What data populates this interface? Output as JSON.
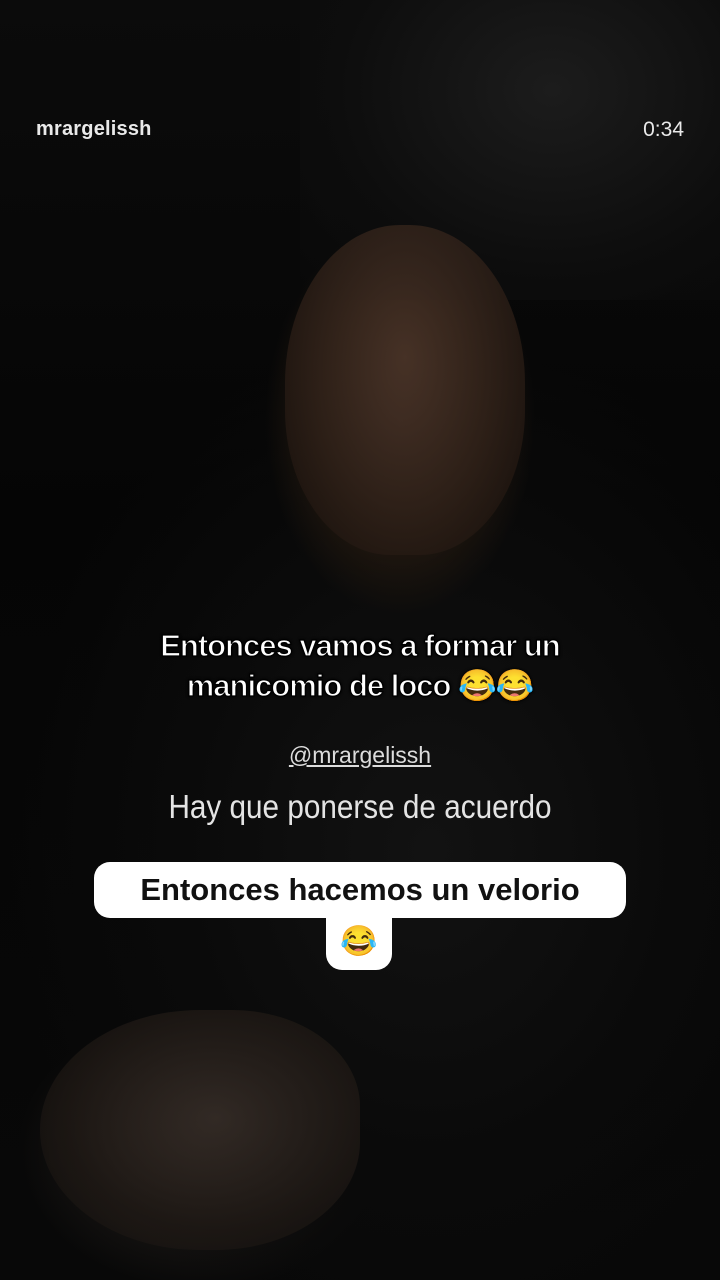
{
  "header": {
    "username": "mrargelissh",
    "timestamp": "0:34"
  },
  "overlay": {
    "caption_line1": "Entonces vamos a formar un",
    "caption_line2": "manicomio de loco 😂😂",
    "mention": "@mrargelissh",
    "subtitle": "Hay que ponerse de acuerdo",
    "bubble_text": "Entonces hacemos un velorio",
    "bubble_emoji": "😂"
  }
}
